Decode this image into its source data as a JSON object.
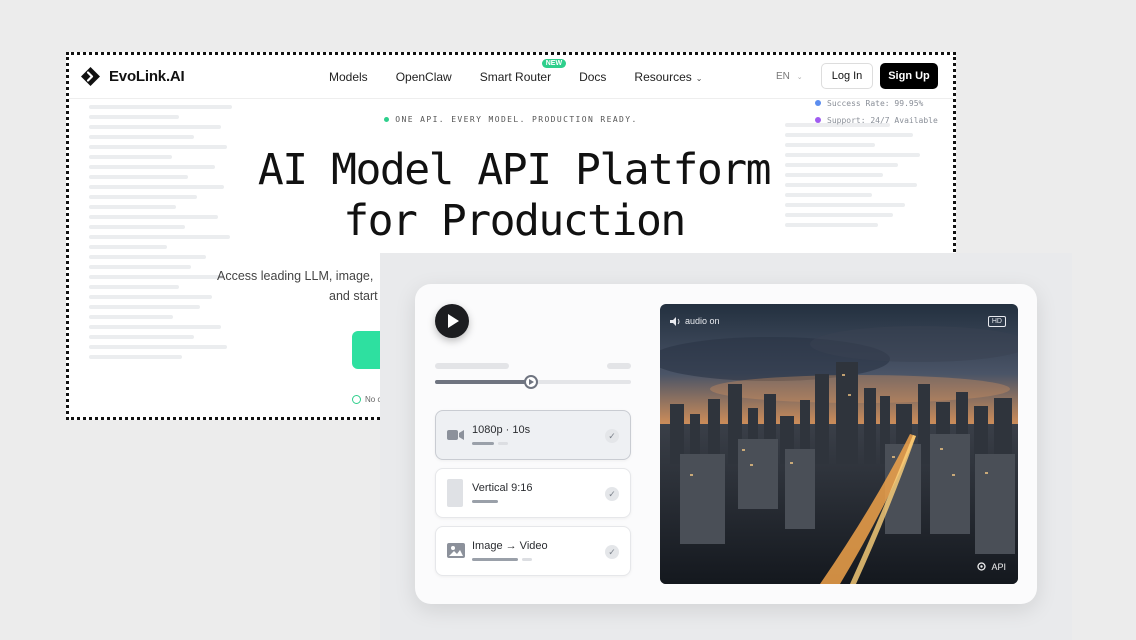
{
  "brand": {
    "name": "EvoLink.AI"
  },
  "nav": {
    "items": [
      {
        "label": "Models"
      },
      {
        "label": "OpenClaw"
      },
      {
        "label": "Smart Router",
        "badge": "NEW"
      },
      {
        "label": "Docs"
      },
      {
        "label": "Resources"
      }
    ],
    "lang": "EN",
    "login": "Log In",
    "signup": "Sign Up"
  },
  "status": {
    "success": "Success Rate: 99.95%",
    "support": "Support: 24/7 Available"
  },
  "hero": {
    "tagline": "ONE API. EVERY MODEL. PRODUCTION READY.",
    "title_line1": "AI Model API Platform",
    "title_line2": "for Production",
    "sub_line1": "Access leading LLM, image,",
    "sub_line2": "and start",
    "nocard": "No c"
  },
  "player": {
    "progress": 0.49,
    "options": [
      {
        "label": "1080p · 10s",
        "active": true
      },
      {
        "label": "Vertical 9:16",
        "active": false
      },
      {
        "label": "Image → Video",
        "active": false
      }
    ],
    "video": {
      "audio": "audio on",
      "hd": "HD",
      "api": "API"
    }
  },
  "colors": {
    "accent": "#2ecf8c",
    "dark": "#000000"
  }
}
